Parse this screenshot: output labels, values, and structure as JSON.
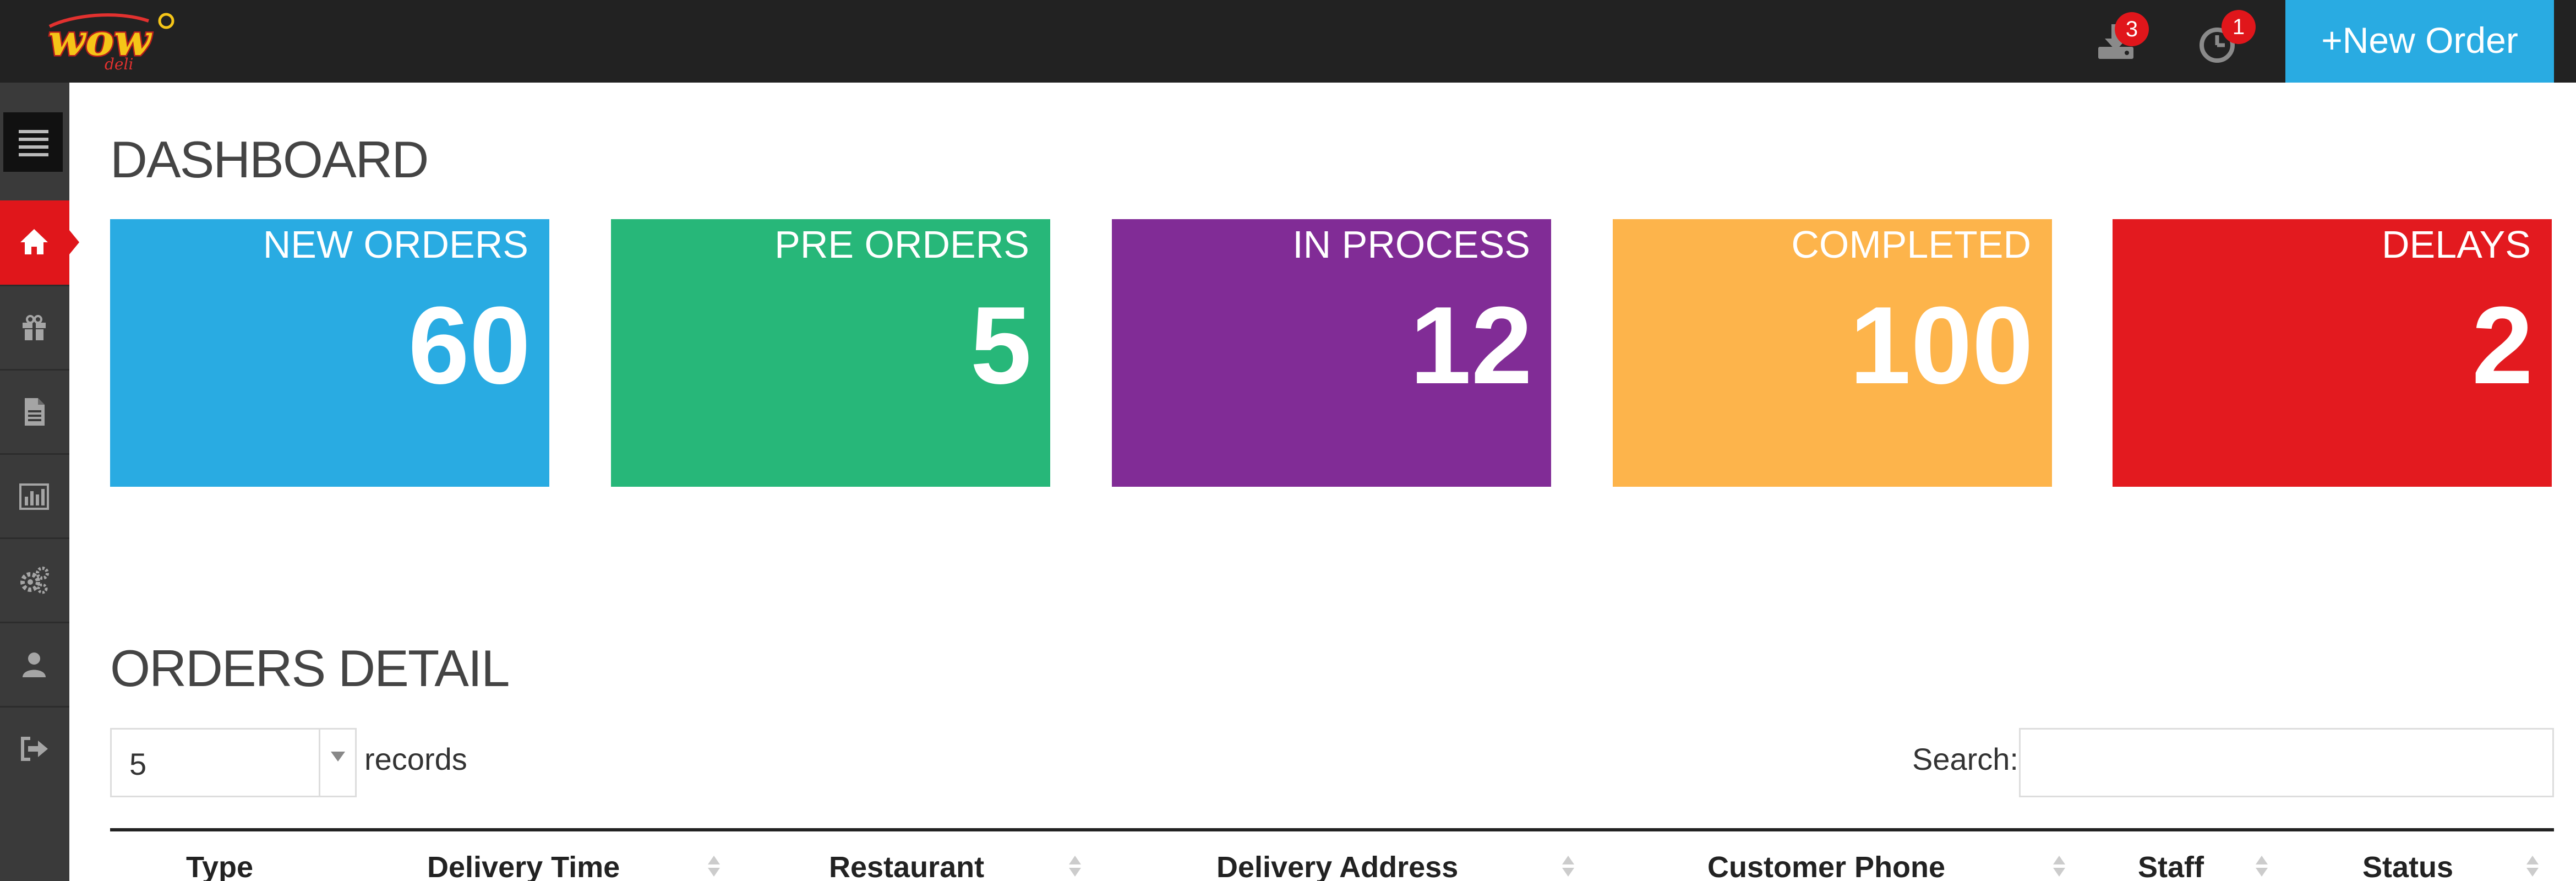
{
  "header": {
    "logo_text": "WOW",
    "downloads_badge": "3",
    "alerts_badge": "1",
    "new_order_label": "+New Order"
  },
  "sidebar": {
    "items": [
      {
        "icon": "home-icon",
        "active": true
      },
      {
        "icon": "gift-icon",
        "active": false
      },
      {
        "icon": "document-icon",
        "active": false
      },
      {
        "icon": "bar-chart-icon",
        "active": false
      },
      {
        "icon": "gears-icon",
        "active": false
      },
      {
        "icon": "user-icon",
        "active": false
      },
      {
        "icon": "sign-out-icon",
        "active": false
      }
    ]
  },
  "dashboard": {
    "title": "DASHBOARD",
    "cards": [
      {
        "label": "NEW ORDERS",
        "value": "60",
        "color": "#29abe2"
      },
      {
        "label": "PRE ORDERS",
        "value": "5",
        "color": "#27b779"
      },
      {
        "label": "IN PROCESS",
        "value": "12",
        "color": "#812c96"
      },
      {
        "label": "COMPLETED",
        "value": "100",
        "color": "#fdb44b"
      },
      {
        "label": "DELAYS",
        "value": "2",
        "color": "#e31a1f"
      }
    ]
  },
  "orders": {
    "title": "ORDERS DETAIL",
    "page_size": "5",
    "records_label": "records",
    "search_label": "Search:",
    "search_value": "",
    "columns": [
      "Type",
      "Delivery Time",
      "Restaurant",
      "Delivery Address",
      "Customer Phone",
      "Staff",
      "Status"
    ]
  },
  "colors": {
    "topbar": "#222222",
    "sidebar": "#3a3a3a",
    "accent_blue": "#29abe2",
    "accent_red": "#e0161b"
  }
}
